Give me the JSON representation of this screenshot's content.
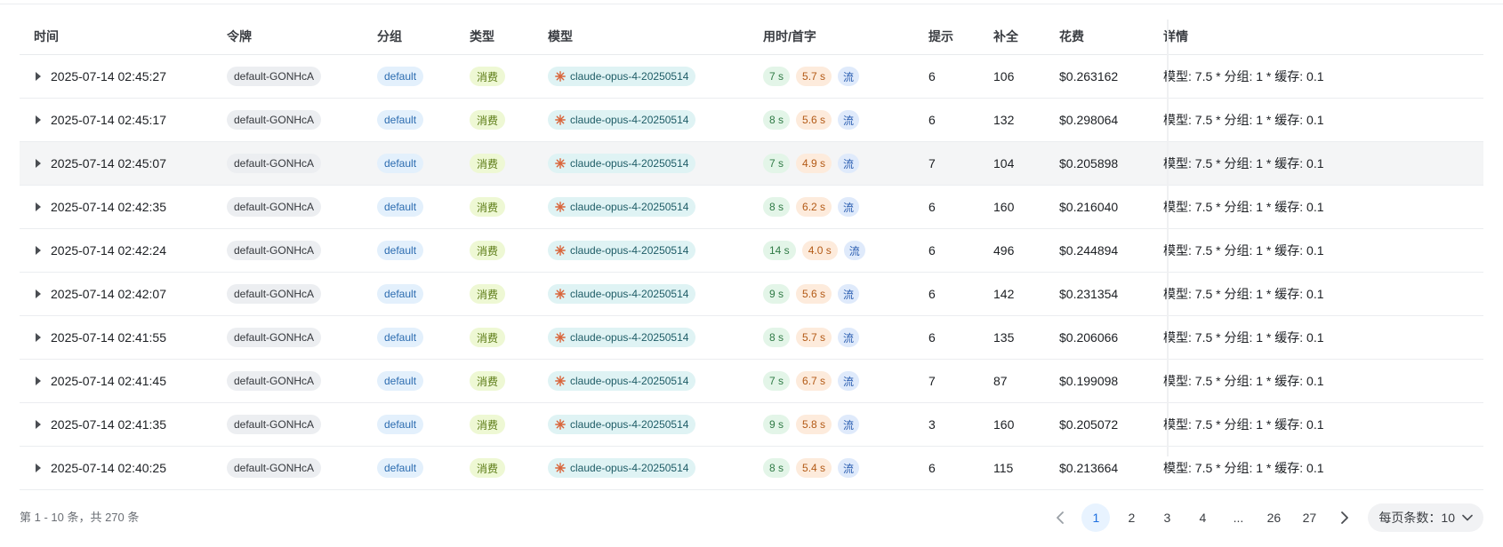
{
  "table": {
    "headers": {
      "time": "时间",
      "token": "令牌",
      "group": "分组",
      "type": "类型",
      "model": "模型",
      "timing": "用时/首字",
      "prompt": "提示",
      "completion": "补全",
      "cost": "花费",
      "details": "详情"
    },
    "rows": [
      {
        "time": "2025-07-14 02:45:27",
        "token": "default-GONHcA",
        "group": "default",
        "type": "消费",
        "model": "claude-opus-4-20250514",
        "use_time": "7 s",
        "first_token": "5.7 s",
        "stream": "流",
        "prompt": "6",
        "completion": "106",
        "cost": "$0.263162",
        "details": "模型: 7.5 * 分组: 1 * 缓存: 0.1"
      },
      {
        "time": "2025-07-14 02:45:17",
        "token": "default-GONHcA",
        "group": "default",
        "type": "消费",
        "model": "claude-opus-4-20250514",
        "use_time": "8 s",
        "first_token": "5.6 s",
        "stream": "流",
        "prompt": "6",
        "completion": "132",
        "cost": "$0.298064",
        "details": "模型: 7.5 * 分组: 1 * 缓存: 0.1"
      },
      {
        "time": "2025-07-14 02:45:07",
        "token": "default-GONHcA",
        "group": "default",
        "type": "消费",
        "model": "claude-opus-4-20250514",
        "use_time": "7 s",
        "first_token": "4.9 s",
        "stream": "流",
        "prompt": "7",
        "completion": "104",
        "cost": "$0.205898",
        "details": "模型: 7.5 * 分组: 1 * 缓存: 0.1"
      },
      {
        "time": "2025-07-14 02:42:35",
        "token": "default-GONHcA",
        "group": "default",
        "type": "消费",
        "model": "claude-opus-4-20250514",
        "use_time": "8 s",
        "first_token": "6.2 s",
        "stream": "流",
        "prompt": "6",
        "completion": "160",
        "cost": "$0.216040",
        "details": "模型: 7.5 * 分组: 1 * 缓存: 0.1"
      },
      {
        "time": "2025-07-14 02:42:24",
        "token": "default-GONHcA",
        "group": "default",
        "type": "消费",
        "model": "claude-opus-4-20250514",
        "use_time": "14 s",
        "first_token": "4.0 s",
        "stream": "流",
        "prompt": "6",
        "completion": "496",
        "cost": "$0.244894",
        "details": "模型: 7.5 * 分组: 1 * 缓存: 0.1"
      },
      {
        "time": "2025-07-14 02:42:07",
        "token": "default-GONHcA",
        "group": "default",
        "type": "消费",
        "model": "claude-opus-4-20250514",
        "use_time": "9 s",
        "first_token": "5.6 s",
        "stream": "流",
        "prompt": "6",
        "completion": "142",
        "cost": "$0.231354",
        "details": "模型: 7.5 * 分组: 1 * 缓存: 0.1"
      },
      {
        "time": "2025-07-14 02:41:55",
        "token": "default-GONHcA",
        "group": "default",
        "type": "消费",
        "model": "claude-opus-4-20250514",
        "use_time": "8 s",
        "first_token": "5.7 s",
        "stream": "流",
        "prompt": "6",
        "completion": "135",
        "cost": "$0.206066",
        "details": "模型: 7.5 * 分组: 1 * 缓存: 0.1"
      },
      {
        "time": "2025-07-14 02:41:45",
        "token": "default-GONHcA",
        "group": "default",
        "type": "消费",
        "model": "claude-opus-4-20250514",
        "use_time": "7 s",
        "first_token": "6.7 s",
        "stream": "流",
        "prompt": "7",
        "completion": "87",
        "cost": "$0.199098",
        "details": "模型: 7.5 * 分组: 1 * 缓存: 0.1"
      },
      {
        "time": "2025-07-14 02:41:35",
        "token": "default-GONHcA",
        "group": "default",
        "type": "消费",
        "model": "claude-opus-4-20250514",
        "use_time": "9 s",
        "first_token": "5.8 s",
        "stream": "流",
        "prompt": "3",
        "completion": "160",
        "cost": "$0.205072",
        "details": "模型: 7.5 * 分组: 1 * 缓存: 0.1"
      },
      {
        "time": "2025-07-14 02:40:25",
        "token": "default-GONHcA",
        "group": "default",
        "type": "消费",
        "model": "claude-opus-4-20250514",
        "use_time": "8 s",
        "first_token": "5.4 s",
        "stream": "流",
        "prompt": "6",
        "completion": "115",
        "cost": "$0.213664",
        "details": "模型: 7.5 * 分组: 1 * 缓存: 0.1"
      }
    ],
    "hover_row_index": 2
  },
  "pagination": {
    "summary": "第 1 - 10 条，共 270 条",
    "prev_icon": "chevron-left-icon",
    "next_icon": "chevron-right-icon",
    "pages": [
      "1",
      "2",
      "3",
      "4",
      "...",
      "26",
      "27"
    ],
    "current_page": "1",
    "page_size_label": "每页条数：10"
  },
  "icons": {
    "expand": "caret-right-icon",
    "model": "anthropic-star-icon",
    "page_size": "chevron-down-icon"
  },
  "colors": {
    "active_page": "#1e6fe0",
    "model_icon": "#d9643a"
  }
}
